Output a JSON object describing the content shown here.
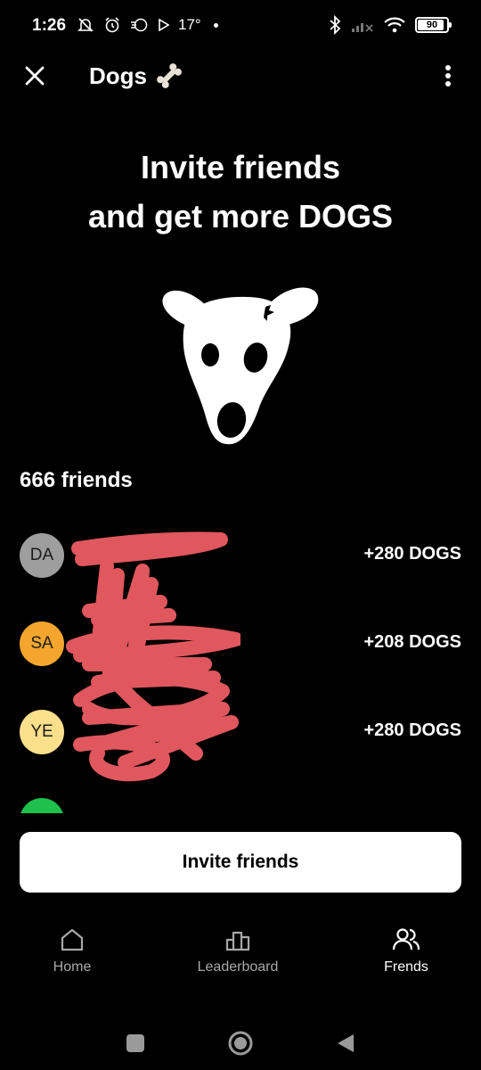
{
  "status_bar": {
    "time": "1:26",
    "temperature": "17°",
    "battery": "90",
    "icons_left": [
      "bell-off-icon",
      "alarm-icon",
      "sync-icon",
      "play-icon"
    ],
    "icons_right": [
      "bluetooth-icon",
      "signal-icon",
      "wifi-icon",
      "battery-icon"
    ]
  },
  "header": {
    "title": "Dogs",
    "title_icon": "bone-icon",
    "close_icon": "close-icon",
    "menu_icon": "more-vertical-icon"
  },
  "hero": {
    "title_line1": "Invite friends",
    "title_line2": "and get more DOGS",
    "logo": "dog-face-logo"
  },
  "friends": {
    "count_label": "666 friends",
    "items": [
      {
        "initials": "DA",
        "name": "",
        "reward": "+280 DOGS",
        "avatar_color": "#9e9e9e"
      },
      {
        "initials": "SA",
        "name": "",
        "reward": "+208 DOGS",
        "avatar_color": "#f3a52d"
      },
      {
        "initials": "YE",
        "name": "",
        "reward": "+280 DOGS",
        "avatar_color": "#fbe08c"
      },
      {
        "initials": "",
        "name": "",
        "reward": "",
        "avatar_color": "#1fc14d"
      }
    ]
  },
  "invite_button": {
    "label": "Invite friends"
  },
  "bottom_nav": {
    "items": [
      {
        "label": "Home",
        "icon": "home-icon",
        "active": false
      },
      {
        "label": "Leaderboard",
        "icon": "leaderboard-icon",
        "active": false
      },
      {
        "label": "Frends",
        "icon": "friends-icon",
        "active": true
      }
    ]
  },
  "system_nav": {
    "items": [
      "recent-apps-icon",
      "home-circle-icon",
      "back-icon"
    ]
  },
  "colors": {
    "background": "#000000",
    "text": "#ffffff",
    "muted_text": "#a8a8a8",
    "button_bg": "#ffffff",
    "scribble": "#e0575e"
  }
}
